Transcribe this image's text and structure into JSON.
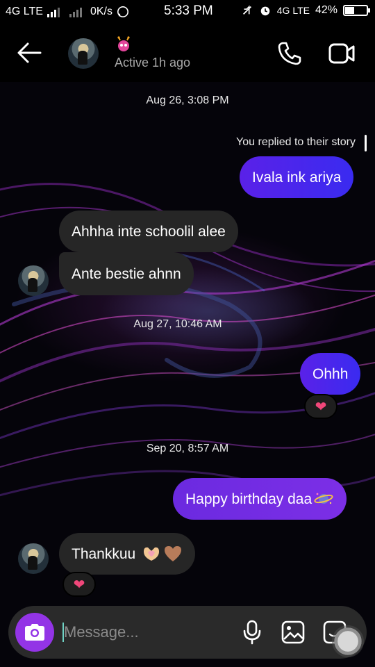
{
  "status_bar": {
    "network_left": "4G LTE",
    "speed": "0K/s",
    "time": "5:33 PM",
    "network_right": "4G LTE",
    "battery": "42%",
    "battery_level": 0.42
  },
  "header": {
    "status": "Active 1h ago",
    "icons": [
      "back-arrow-icon",
      "alien-emoji-icon",
      "phone-icon",
      "video-camera-icon"
    ]
  },
  "messages": {
    "ts1": "Aug 26, 3:08 PM",
    "reply_note": "You replied to their story",
    "m1": "Ivala ink ariya",
    "m2": "Ahhha inte schoolil alee",
    "m3": "Ante bestie ahnn",
    "ts2": "Aug 27, 10:46 AM",
    "m4": "Ohhh",
    "ts3": "Sep 20, 8:57 AM",
    "m5": "Happy birthday daa",
    "m6": "Thankkuu",
    "reaction": "❤"
  },
  "composer": {
    "placeholder": "Message...",
    "icons": [
      "camera-icon",
      "microphone-icon",
      "gallery-icon",
      "sticker-icon"
    ]
  },
  "colors": {
    "outgoing": "#4a25ee",
    "outgoing_alt": "#7a2ee4",
    "incoming": "#262626",
    "camera_button": "#9334e6",
    "reaction_heart": "#f0477a"
  }
}
